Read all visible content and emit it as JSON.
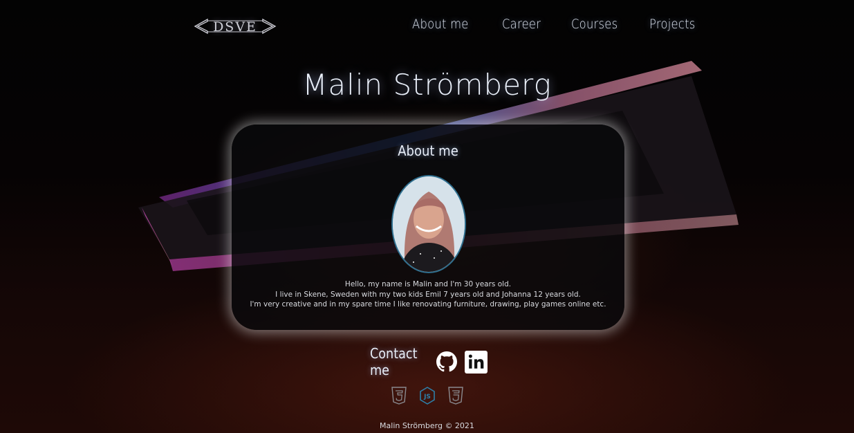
{
  "header": {
    "logo_text": "<DSVE>",
    "nav": [
      {
        "label": "About me"
      },
      {
        "label": "Career"
      },
      {
        "label": "Courses"
      },
      {
        "label": "Projects"
      }
    ]
  },
  "hero": {
    "name": "Malin Strömberg"
  },
  "about": {
    "title": "About me",
    "bio": [
      "Hello, my name is Malin and I'm 30 years old.",
      "I live in Skene, Sweden with my two kids Emil 7 years old and Johanna 12 years old.",
      "I'm very creative and in my spare time I like renovating furniture, drawing, play games online etc."
    ]
  },
  "contact": {
    "label": "Contact me",
    "icons": [
      "github-icon",
      "linkedin-icon"
    ]
  },
  "tech_icons": [
    "html5-icon",
    "nodejs-icon",
    "css3-icon"
  ],
  "footer": {
    "text": "Malin Strömberg © 2021"
  },
  "colors": {
    "accent_glow": "#c8d6ff",
    "text": "#e8eef8",
    "avatar_border": "#2f6f8f",
    "card_bg": "#0a0a0c"
  }
}
